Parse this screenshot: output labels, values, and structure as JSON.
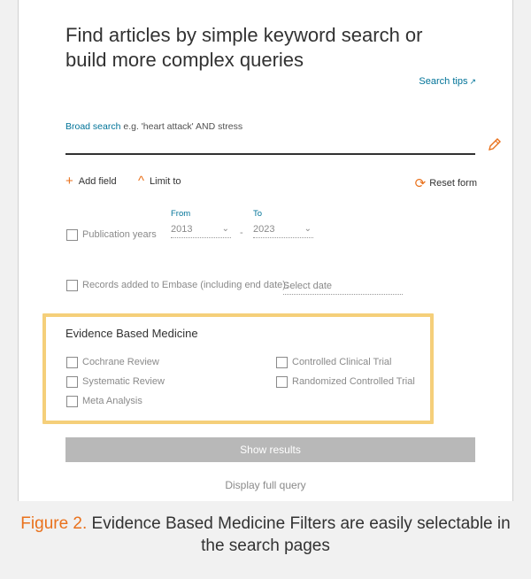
{
  "heading": "Find articles by simple keyword search or build more complex queries",
  "search_tips": {
    "label": "Search tips",
    "icon": "external-link-icon"
  },
  "broad_search": {
    "link": "Broad search",
    "example": " e.g. 'heart attack' AND stress"
  },
  "edit_icon": "pencil-icon",
  "toolbar": {
    "add_field": "Add field",
    "limit_to": "Limit to",
    "reset_form": "Reset form"
  },
  "publication_years": {
    "label": "Publication years",
    "from_label": "From",
    "to_label": "To",
    "from_value": "2013",
    "to_value": "2023"
  },
  "records_added": {
    "label": "Records added to Embase (including end date):",
    "placeholder": "Select date"
  },
  "ebm": {
    "title": "Evidence Based Medicine",
    "options": [
      "Cochrane Review",
      "Systematic Review",
      "Meta Analysis",
      "Controlled Clinical Trial",
      "Randomized Controlled Trial"
    ]
  },
  "show_results": "Show results",
  "display_full_query": "Display full query",
  "caption": {
    "figure": "Figure 2.",
    "text": " Evidence Based Medicine Filters are easily selectable in the search pages"
  },
  "colors": {
    "accent_orange": "#e9711c",
    "link_blue": "#007398",
    "highlight_box": "#f5cf7a",
    "button_gray": "#b8b8b8"
  }
}
